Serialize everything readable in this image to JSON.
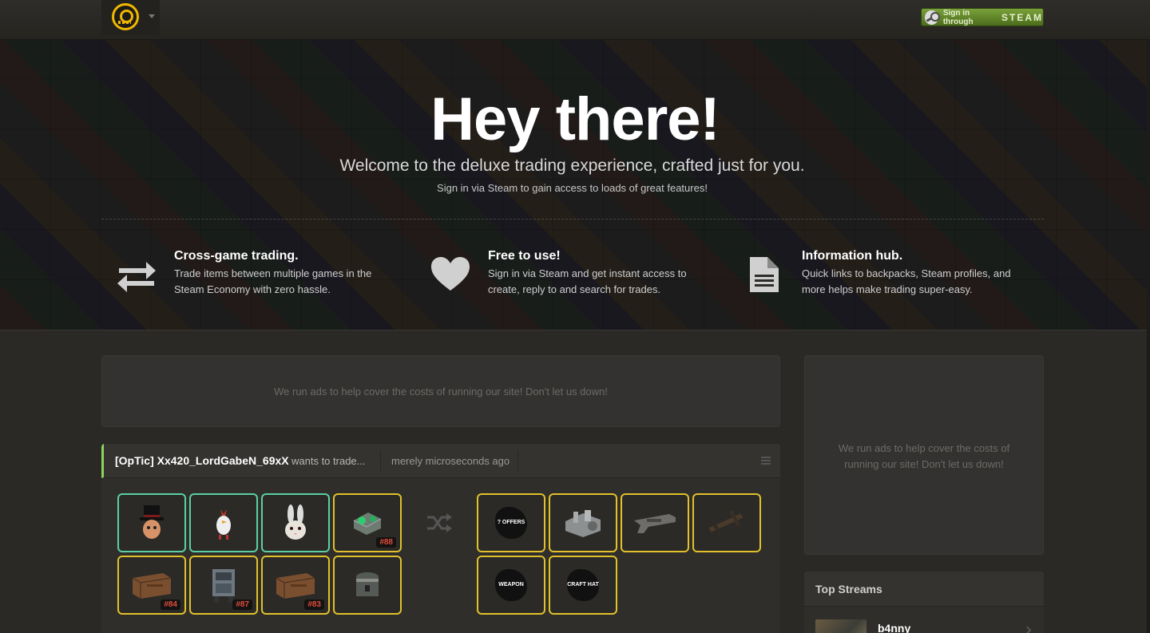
{
  "topbar": {
    "logo_alt": "backpack.tf logo",
    "steam_prefix": "Sign in through",
    "steam_word": "STEAM"
  },
  "hero": {
    "title": "Hey there!",
    "subtitle": "Welcome to the deluxe trading experience, crafted just for you.",
    "subtitle2": "Sign in via Steam to gain access to loads of great features!"
  },
  "features": [
    {
      "icon": "exchange-arrows-icon",
      "title": "Cross-game trading.",
      "text": "Trade items between multiple games in the Steam Economy with zero hassle."
    },
    {
      "icon": "heart-icon",
      "title": "Free to use!",
      "text": "Sign in via Steam and get instant access to create, reply to and search for trades."
    },
    {
      "icon": "document-icon",
      "title": "Information hub.",
      "text": "Quick links to backpacks, Steam profiles, and more helps make trading super-easy."
    }
  ],
  "ads": {
    "main": "We run ads to help cover the costs of running our site! Don't let us down!",
    "side": "We run ads to help cover the costs of running our site! Don't let us down!"
  },
  "trade": {
    "user": "[OpTic] Xx420_LordGabeN_69xX",
    "wants": "wants to trade...",
    "time": "merely microseconds ago",
    "offer_items": [
      {
        "name": "top-hat-item",
        "border": "teal",
        "num": ""
      },
      {
        "name": "chicken-hat-item",
        "border": "teal",
        "num": ""
      },
      {
        "name": "rabbit-mask-item",
        "border": "teal",
        "num": ""
      },
      {
        "name": "robot-part-item",
        "border": "yellow",
        "num": "#88"
      },
      {
        "name": "crate-item",
        "border": "yellow",
        "num": "#84"
      },
      {
        "name": "robo-crate-item",
        "border": "yellow",
        "num": "#87"
      },
      {
        "name": "crate-item",
        "border": "yellow",
        "num": "#83"
      },
      {
        "name": "locked-crate-item",
        "border": "yellow",
        "num": ""
      }
    ],
    "want_items": [
      {
        "name": "offers-label",
        "label": "? OFFERS"
      },
      {
        "name": "machine-part-item",
        "label": ""
      },
      {
        "name": "gun-item",
        "label": ""
      },
      {
        "name": "crossbow-item",
        "label": ""
      },
      {
        "name": "weapon-label",
        "label": "WEAPON"
      },
      {
        "name": "craft-hat-label",
        "label": "CRAFT HAT"
      }
    ]
  },
  "streams": {
    "title": "Top Streams",
    "first_name": "b4nny"
  }
}
